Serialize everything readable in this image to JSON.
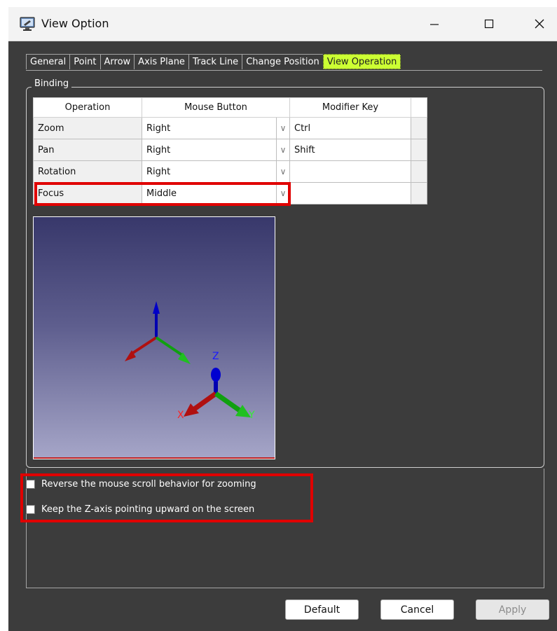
{
  "window": {
    "title": "View Option"
  },
  "tabs": [
    "General",
    "Point",
    "Arrow",
    "Axis Plane",
    "Track Line",
    "Change Position",
    "View Operation"
  ],
  "active_tab": "View Operation",
  "binding": {
    "legend": "Binding",
    "columns": [
      "Operation",
      "Mouse Button",
      "Modifier Key"
    ],
    "rows": [
      {
        "operation": "Zoom",
        "mouse_button": "Right",
        "modifier": "Ctrl"
      },
      {
        "operation": "Pan",
        "mouse_button": "Right",
        "modifier": "Shift"
      },
      {
        "operation": "Rotation",
        "mouse_button": "Right",
        "modifier": ""
      },
      {
        "operation": "Focus",
        "mouse_button": "Middle",
        "modifier": ""
      }
    ]
  },
  "axis_labels": {
    "z": "Z",
    "x": "X",
    "y": "Y"
  },
  "options": [
    {
      "label": "Reverse the mouse scroll behavior for zooming",
      "checked": false
    },
    {
      "label": "Keep the Z-axis pointing upward on the screen",
      "checked": false
    }
  ],
  "buttons": {
    "default": "Default",
    "cancel": "Cancel",
    "apply": "Apply"
  },
  "colors": {
    "active_tab": "#ccff33",
    "highlight": "#e00000",
    "background": "#3c3c3c"
  }
}
